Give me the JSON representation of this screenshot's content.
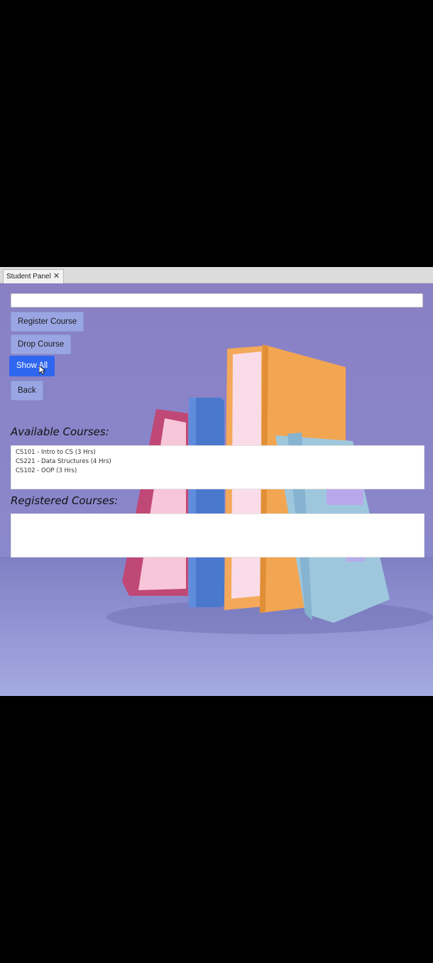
{
  "tabs": [
    {
      "label": "Student Panel",
      "close": "✕"
    }
  ],
  "search": {
    "value": ""
  },
  "buttons": {
    "register": "Register Course",
    "drop": "Drop Course",
    "show_all": "Show All",
    "back": "Back"
  },
  "available": {
    "label": "Available Courses:",
    "items": [
      "CS101 - Intro to CS (3 Hrs)",
      "CS221 - Data Structures (4 Hrs)",
      "CS102 - OOP (3 Hrs)"
    ]
  },
  "registered": {
    "label": "Registered Courses:",
    "items": []
  },
  "colors": {
    "background": "#8a84c6",
    "button": "#9aa6e3",
    "active_button": "#2e66f0"
  }
}
